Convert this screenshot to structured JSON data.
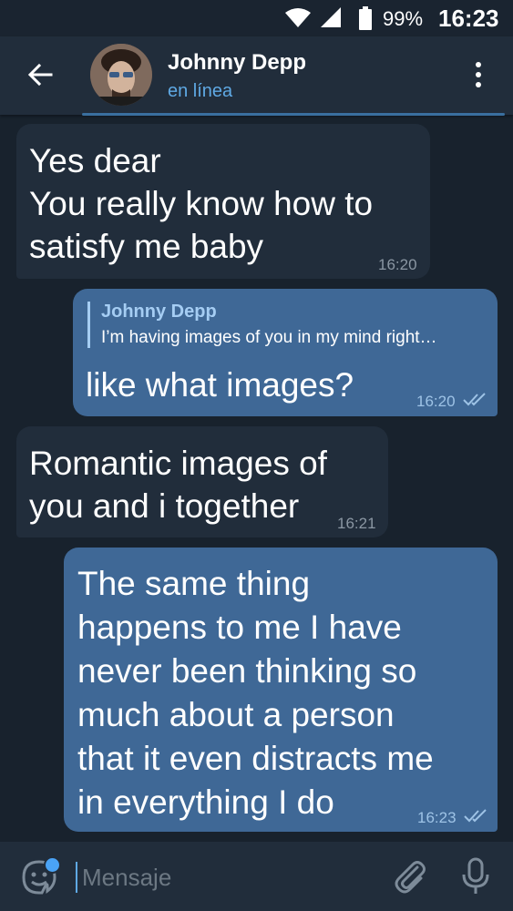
{
  "status_bar": {
    "battery_percent": "99%",
    "time": "16:23"
  },
  "header": {
    "contact_name": "Johnny Depp",
    "contact_status": "en línea",
    "avatar_icon": "avatar-photo"
  },
  "messages": [
    {
      "direction": "incoming",
      "text": "Yes dear\nYou really know how to\nsatisfy me baby",
      "time": "16:20"
    },
    {
      "direction": "outgoing",
      "reply_to_name": "Johnny Depp",
      "reply_to_text": "I’m having images of you in my mind right…",
      "text": "like what images?",
      "time": "16:20",
      "read": true
    },
    {
      "direction": "incoming",
      "text": "Romantic images of\nyou and i together",
      "time": "16:21"
    },
    {
      "direction": "outgoing",
      "text": "The same thing\nhappens to me I have\nnever been thinking so\nmuch about a person\nthat it even distracts me\nin everything I do",
      "time": "16:23",
      "read": true
    }
  ],
  "input_bar": {
    "placeholder": "Mensaje"
  },
  "colors": {
    "background": "#18222d",
    "incoming_bubble": "#212d3b",
    "outgoing_bubble": "#3f6896",
    "accent": "#5fa9e4"
  }
}
